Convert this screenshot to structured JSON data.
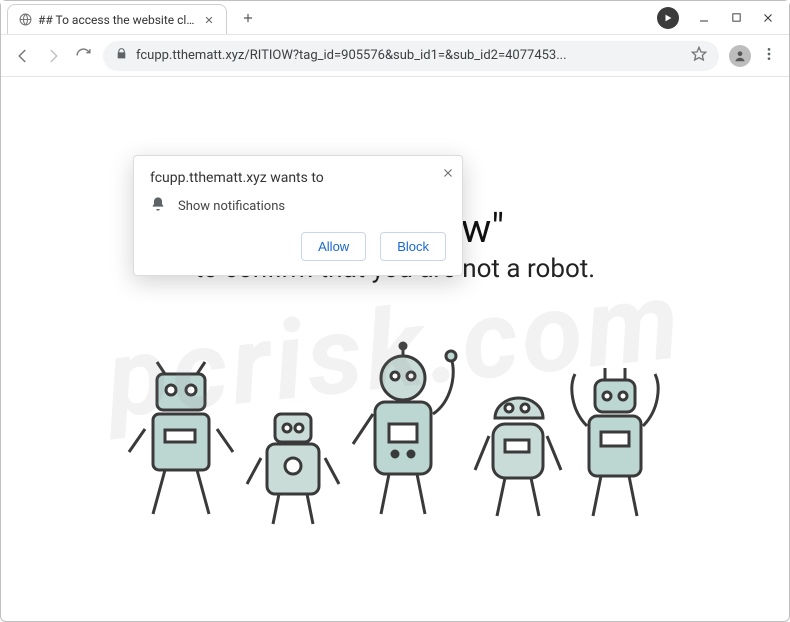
{
  "window": {
    "tab_title": "## To access the website click the",
    "new_tab_icon": "plus-icon"
  },
  "toolbar": {
    "url_display": "fcupp.tthematt.xyz/RITIOW?tag_id=905576&sub_id1=&sub_id2=4077453...",
    "host": "fcupp.tthematt.xyz"
  },
  "permission": {
    "prompt": "fcupp.tthematt.xyz wants to",
    "item": "Show notifications",
    "allow": "Allow",
    "block": "Block"
  },
  "page": {
    "headline": "Click \"Allow\"",
    "subline": "to confirm that you are not a robot."
  },
  "watermark": "pcrisk.com"
}
